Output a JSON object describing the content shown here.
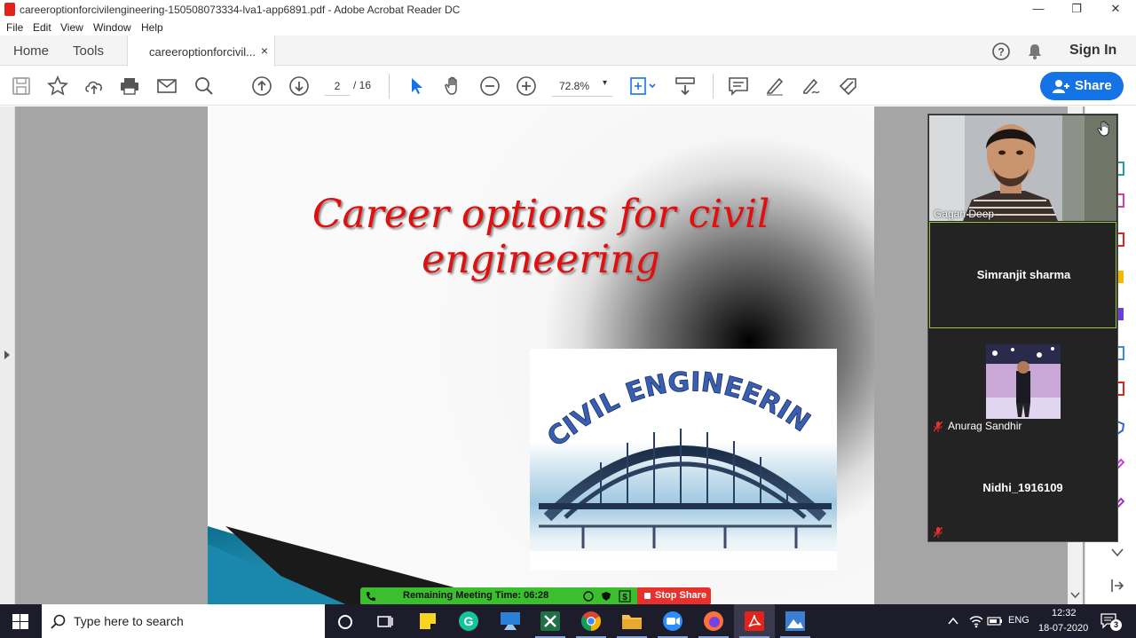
{
  "window": {
    "title": "careeroptionforcivilengineering-150508073334-lva1-app6891.pdf - Adobe Acrobat Reader DC",
    "minimize": "—",
    "restore": "❐",
    "close": "✕"
  },
  "menu": [
    "File",
    "Edit",
    "View",
    "Window",
    "Help"
  ],
  "tabs": {
    "home": "Home",
    "tools": "Tools",
    "document": "careeroptionforcivil...",
    "close": "×",
    "sign_in": "Sign In"
  },
  "toolbar": {
    "page_current": "2",
    "page_separator": "/ 16",
    "zoom": "72.8%",
    "zoom_caret": "▾",
    "share": "Share"
  },
  "slide": {
    "title": "Career  options  for civil engineering",
    "image_text": "CIVIL ENGINEERING"
  },
  "participants": [
    {
      "name": "Gagan Deep",
      "video": true
    },
    {
      "name": "Simranjit sharma",
      "video": false
    },
    {
      "name": "Anurag Sandhir",
      "video": false,
      "avatar": true,
      "muted": true
    },
    {
      "name": "Nidhi_1916109",
      "video": false,
      "muted": true
    }
  ],
  "meeting": {
    "remaining": "Remaining Meeting Time: 06:28",
    "stop_share": "Stop Share"
  },
  "taskbar": {
    "search_placeholder": "Type here to search",
    "language": "ENG",
    "time": "12:32",
    "date": "18-07-2020",
    "notifications": "3"
  },
  "colors": {
    "acrobat_red": "#e2231a",
    "share_blue": "#1473e6",
    "title_red": "#e01010",
    "meeting_green": "#3cbf2e",
    "stop_red": "#e8302c"
  }
}
